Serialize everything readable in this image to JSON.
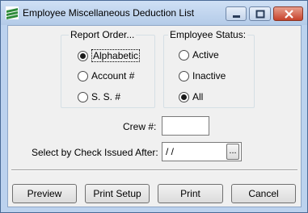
{
  "window": {
    "title": "Employee Miscellaneous Deduction List"
  },
  "report_order": {
    "label": "Report Order...",
    "options": [
      "Alphabetic",
      "Account #",
      "S. S. #"
    ],
    "selected": "Alphabetic"
  },
  "employee_status": {
    "label": "Employee Status:",
    "options": [
      "Active",
      "Inactive",
      "All"
    ],
    "selected": "All"
  },
  "crew": {
    "label": "Crew #:",
    "value": ""
  },
  "check_issued": {
    "label": "Select by Check Issued After:",
    "value": " / /",
    "browse_label": "..."
  },
  "buttons": {
    "preview": "Preview",
    "print_setup": "Print Setup",
    "print": "Print",
    "cancel": "Cancel"
  }
}
